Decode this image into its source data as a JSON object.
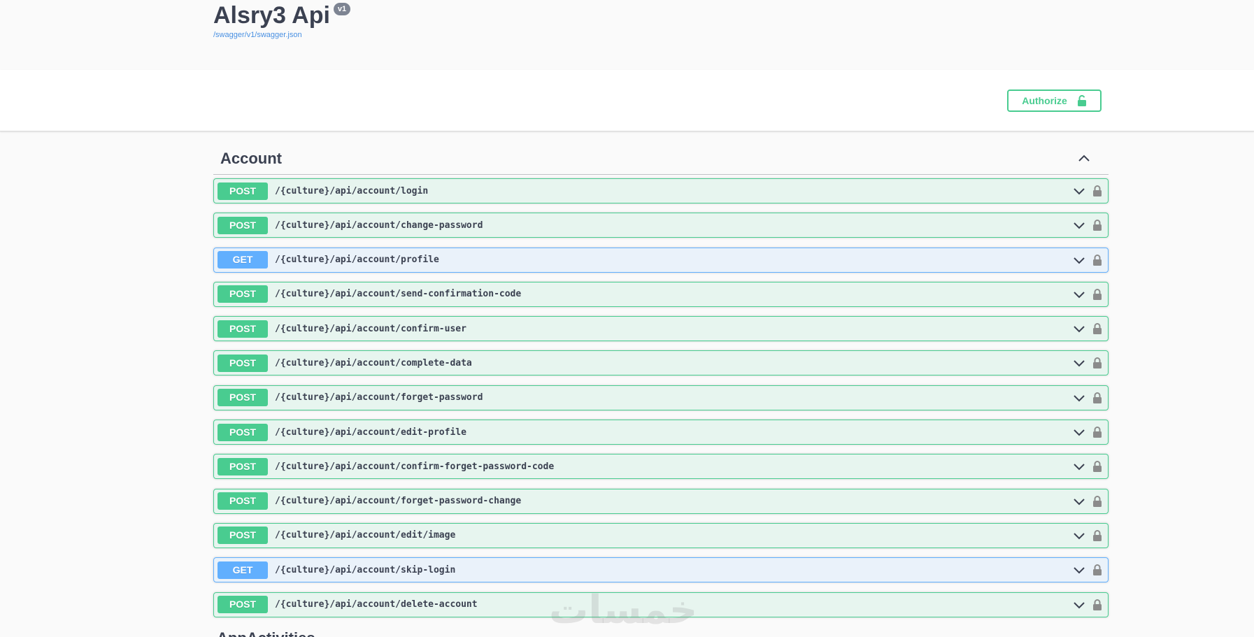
{
  "info": {
    "title": "Alsry3 Api",
    "version": "v1",
    "spec_link": "/swagger/v1/swagger.json"
  },
  "scheme": {
    "authorize_label": "Authorize"
  },
  "tag": {
    "name": "Account",
    "operations": [
      {
        "method": "POST",
        "path": "/{culture}/api/account/login"
      },
      {
        "method": "POST",
        "path": "/{culture}/api/account/change-password"
      },
      {
        "method": "GET",
        "path": "/{culture}/api/account/profile"
      },
      {
        "method": "POST",
        "path": "/{culture}/api/account/send-confirmation-code"
      },
      {
        "method": "POST",
        "path": "/{culture}/api/account/confirm-user"
      },
      {
        "method": "POST",
        "path": "/{culture}/api/account/complete-data"
      },
      {
        "method": "POST",
        "path": "/{culture}/api/account/forget-password"
      },
      {
        "method": "POST",
        "path": "/{culture}/api/account/edit-profile"
      },
      {
        "method": "POST",
        "path": "/{culture}/api/account/confirm-forget-password-code"
      },
      {
        "method": "POST",
        "path": "/{culture}/api/account/forget-password-change"
      },
      {
        "method": "POST",
        "path": "/{culture}/api/account/edit/image"
      },
      {
        "method": "GET",
        "path": "/{culture}/api/account/skip-login"
      },
      {
        "method": "POST",
        "path": "/{culture}/api/account/delete-account"
      }
    ]
  },
  "next_tag": {
    "name": "AppActivities"
  },
  "watermark": "خمسات",
  "colors": {
    "post": "#49cc90",
    "get": "#61affe",
    "text": "#3b4151"
  },
  "icons": {
    "authorize": "unlocked-lock-icon",
    "collapse": "chevron-up-icon",
    "expand": "chevron-down-icon",
    "operation_lock": "lock-icon"
  }
}
